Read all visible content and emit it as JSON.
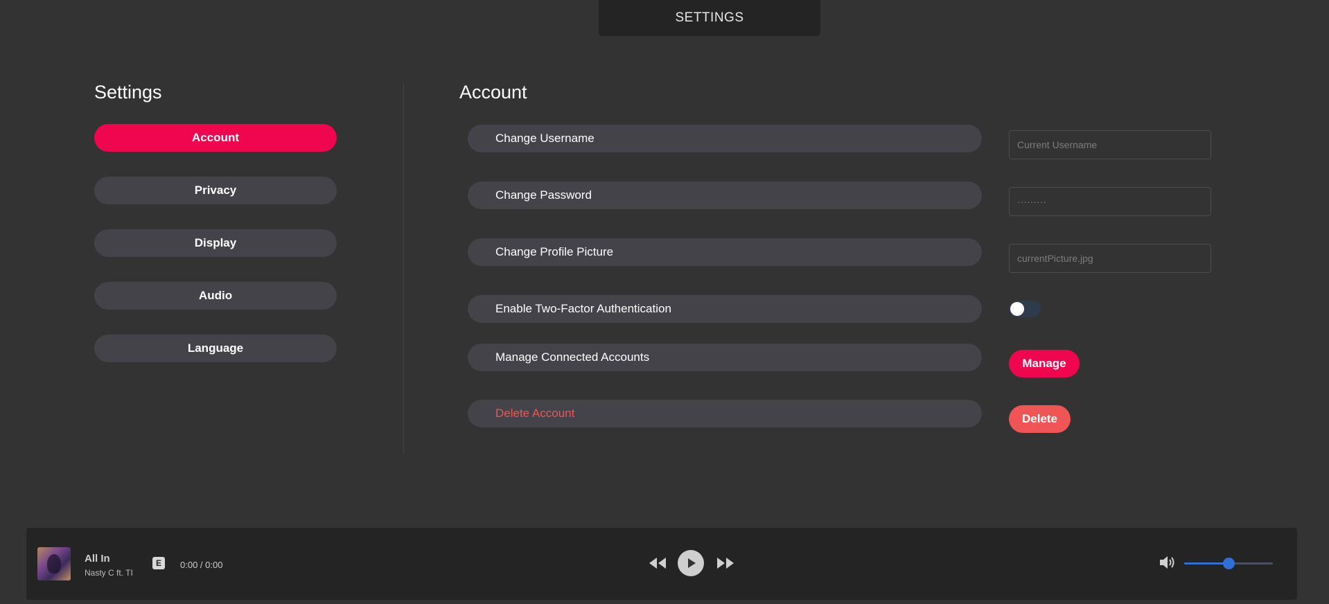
{
  "top_tab": {
    "label": "SETTINGS"
  },
  "sidebar": {
    "title": "Settings",
    "items": [
      {
        "label": "Account",
        "active": true
      },
      {
        "label": "Privacy",
        "active": false
      },
      {
        "label": "Display",
        "active": false
      },
      {
        "label": "Audio",
        "active": false
      },
      {
        "label": "Language",
        "active": false
      }
    ]
  },
  "main": {
    "title": "Account",
    "rows": [
      {
        "label": "Change Username",
        "control": "input",
        "placeholder": "Current Username"
      },
      {
        "label": "Change Password",
        "control": "input",
        "placeholder": "·········"
      },
      {
        "label": "Change Profile Picture",
        "control": "input",
        "placeholder": "currentPicture.jpg"
      },
      {
        "label": "Enable Two-Factor Authentication",
        "control": "toggle",
        "enabled": false
      },
      {
        "label": "Manage Connected Accounts",
        "control": "button",
        "button_label": "Manage"
      },
      {
        "label": "Delete Account",
        "control": "button",
        "button_label": "Delete"
      }
    ]
  },
  "player": {
    "track_title": "All In",
    "artist": "Nasty C ft. TI",
    "explicit_badge": "E",
    "time": "0:00 / 0:00",
    "volume_level": 0.5,
    "icons": {
      "rewind": "rewind-icon",
      "play": "play-icon",
      "forward": "fast-forward-icon",
      "volume": "speaker-icon"
    }
  },
  "colors": {
    "accent": "#f0054f",
    "danger": "#f05555",
    "background": "#333333",
    "pill": "#434349",
    "player": "#242424",
    "volume": "#2f6fd6"
  }
}
